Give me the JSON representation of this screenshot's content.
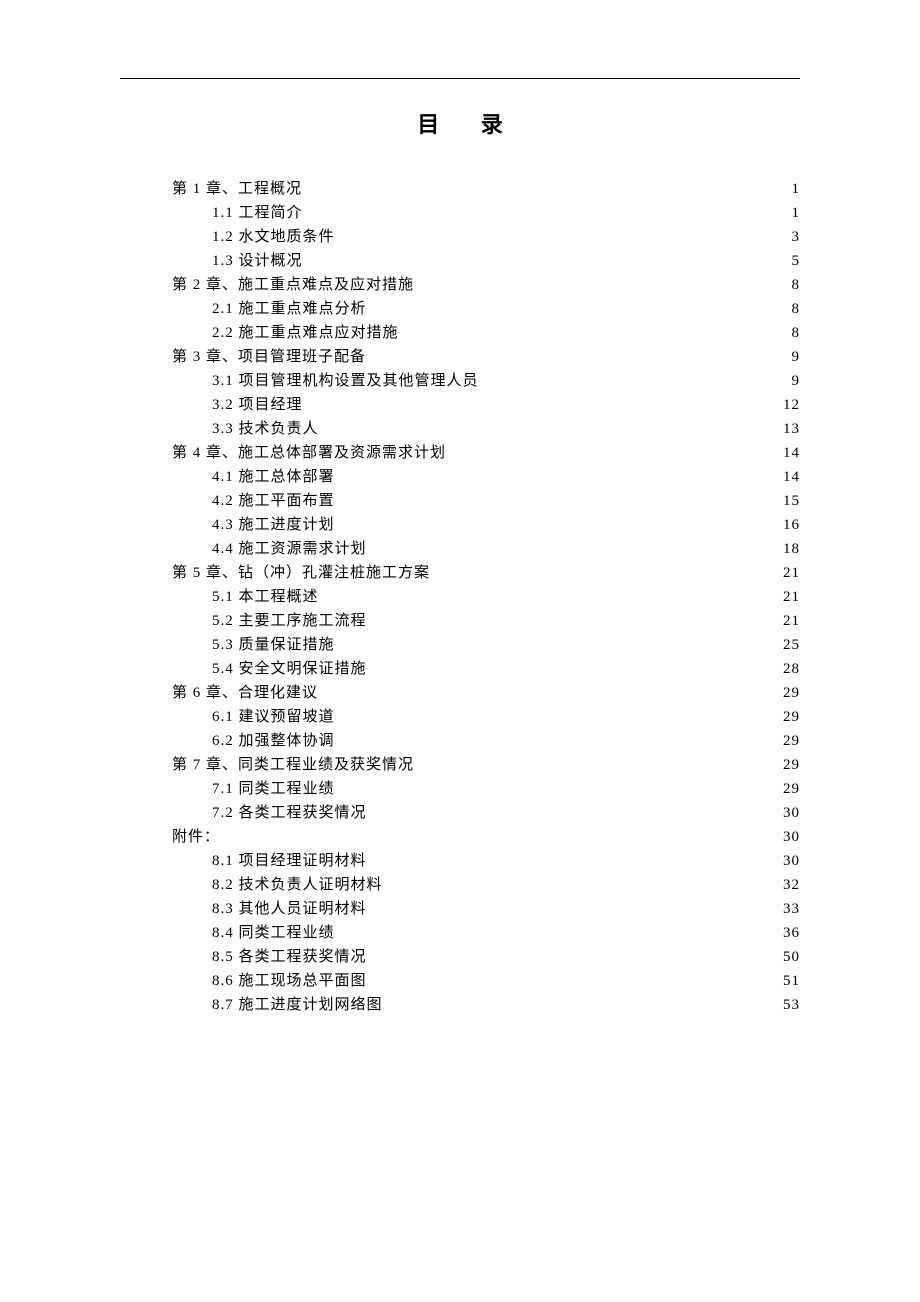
{
  "title": "目 录",
  "toc": [
    {
      "level": 0,
      "label": "第 1 章、工程概况",
      "page": "1"
    },
    {
      "level": 1,
      "label": "1.1 工程简介",
      "page": "1"
    },
    {
      "level": 1,
      "label": "1.2 水文地质条件",
      "page": "3"
    },
    {
      "level": 1,
      "label": "1.3 设计概况",
      "page": "5"
    },
    {
      "level": 0,
      "label": "第 2 章、施工重点难点及应对措施",
      "page": "8"
    },
    {
      "level": 1,
      "label": "2.1 施工重点难点分析",
      "page": "8"
    },
    {
      "level": 1,
      "label": "2.2 施工重点难点应对措施",
      "page": "8"
    },
    {
      "level": 0,
      "label": "第 3 章、项目管理班子配备",
      "page": "9"
    },
    {
      "level": 1,
      "label": "3.1 项目管理机构设置及其他管理人员",
      "page": "9"
    },
    {
      "level": 1,
      "label": "3.2 项目经理",
      "page": "12"
    },
    {
      "level": 1,
      "label": "3.3 技术负责人",
      "page": "13"
    },
    {
      "level": 0,
      "label": "第 4 章、施工总体部署及资源需求计划",
      "page": "14"
    },
    {
      "level": 1,
      "label": "4.1 施工总体部署",
      "page": "14"
    },
    {
      "level": 1,
      "label": "4.2 施工平面布置",
      "page": "15"
    },
    {
      "level": 1,
      "label": "4.3 施工进度计划",
      "page": "16"
    },
    {
      "level": 1,
      "label": "4.4 施工资源需求计划",
      "page": "18"
    },
    {
      "level": 0,
      "label": "第 5 章、钻（冲）孔灌注桩施工方案",
      "page": "21"
    },
    {
      "level": 1,
      "label": "5.1 本工程概述",
      "page": "21"
    },
    {
      "level": 1,
      "label": "5.2 主要工序施工流程",
      "page": "21"
    },
    {
      "level": 1,
      "label": "5.3 质量保证措施",
      "page": "25"
    },
    {
      "level": 1,
      "label": "5.4 安全文明保证措施",
      "page": "28"
    },
    {
      "level": 0,
      "label": "第 6 章、合理化建议",
      "page": "29"
    },
    {
      "level": 1,
      "label": "6.1 建议预留坡道",
      "page": "29"
    },
    {
      "level": 1,
      "label": "6.2 加强整体协调",
      "page": "29"
    },
    {
      "level": 0,
      "label": "第 7 章、同类工程业绩及获奖情况",
      "page": "29"
    },
    {
      "level": 1,
      "label": "7.1 同类工程业绩",
      "page": "29"
    },
    {
      "level": 1,
      "label": "7.2 各类工程获奖情况",
      "page": "30"
    },
    {
      "level": 0,
      "label": "附件：",
      "page": "30"
    },
    {
      "level": 1,
      "label": "8.1 项目经理证明材料",
      "page": "30"
    },
    {
      "level": 1,
      "label": "8.2 技术负责人证明材料",
      "page": "32"
    },
    {
      "level": 1,
      "label": "8.3 其他人员证明材料",
      "page": "33"
    },
    {
      "level": 1,
      "label": "8.4 同类工程业绩",
      "page": "36"
    },
    {
      "level": 1,
      "label": "8.5 各类工程获奖情况",
      "page": "50"
    },
    {
      "level": 1,
      "label": "8.6 施工现场总平面图",
      "page": "51"
    },
    {
      "level": 1,
      "label": "8.7 施工进度计划网络图",
      "page": "53"
    }
  ]
}
